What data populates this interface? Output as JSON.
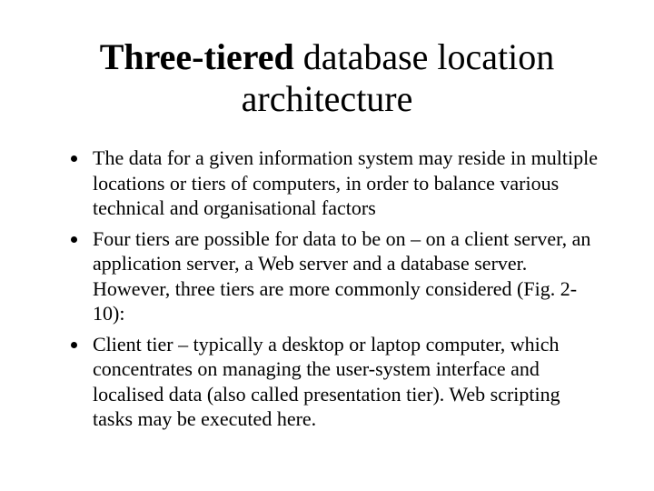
{
  "title": {
    "bold": "Three-tiered",
    "rest": " database location architecture"
  },
  "bullets": [
    "The data for a given information system may reside in multiple locations or tiers of computers, in order to balance various technical and organisational factors",
    "Four tiers are possible for data to be on – on a client server, an application server, a Web server and a database server. However, three tiers are more commonly considered (Fig. 2-10):",
    "Client tier – typically a desktop or laptop computer, which concentrates on managing the user-system interface and localised data (also called presentation tier). Web scripting tasks may be executed here."
  ]
}
